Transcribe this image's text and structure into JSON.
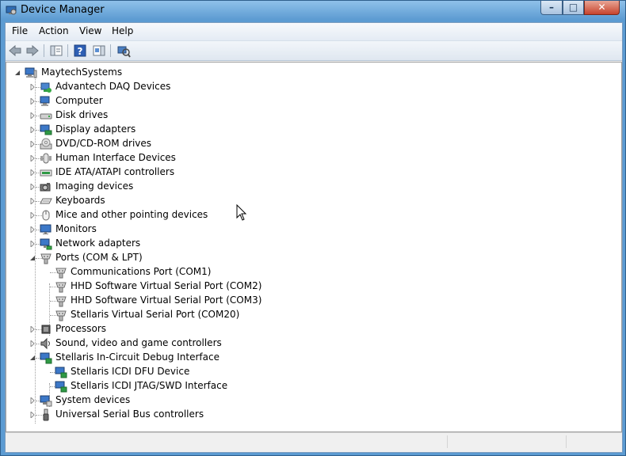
{
  "window": {
    "title": "Device Manager",
    "minimize": "–",
    "maximize": "□",
    "close": "✕"
  },
  "menu": {
    "file": "File",
    "action": "Action",
    "view": "View",
    "help": "Help"
  },
  "toolbar": [
    "back-icon",
    "forward-icon",
    "properties-pane-icon",
    "help-icon",
    "action-pane-icon",
    "scan-hardware-icon"
  ],
  "tree": {
    "root": "MaytechSystems",
    "categories": [
      {
        "label": "Advantech DAQ Devices",
        "icon": "daq-icon",
        "expanded": false
      },
      {
        "label": "Computer",
        "icon": "computer-icon",
        "expanded": false
      },
      {
        "label": "Disk drives",
        "icon": "disk-icon",
        "expanded": false
      },
      {
        "label": "Display adapters",
        "icon": "display-adapter-icon",
        "expanded": false
      },
      {
        "label": "DVD/CD-ROM drives",
        "icon": "dvd-icon",
        "expanded": false
      },
      {
        "label": "Human Interface Devices",
        "icon": "hid-icon",
        "expanded": false
      },
      {
        "label": "IDE ATA/ATAPI controllers",
        "icon": "ide-icon",
        "expanded": false
      },
      {
        "label": "Imaging devices",
        "icon": "camera-icon",
        "expanded": false
      },
      {
        "label": "Keyboards",
        "icon": "keyboard-icon",
        "expanded": false
      },
      {
        "label": "Mice and other pointing devices",
        "icon": "mouse-icon",
        "expanded": false
      },
      {
        "label": "Monitors",
        "icon": "monitor-icon",
        "expanded": false
      },
      {
        "label": "Network adapters",
        "icon": "network-icon",
        "expanded": false
      },
      {
        "label": "Ports (COM & LPT)",
        "icon": "port-icon",
        "expanded": true,
        "children": [
          {
            "label": "Communications Port (COM1)",
            "icon": "port-icon"
          },
          {
            "label": "HHD Software Virtual Serial Port (COM2)",
            "icon": "port-icon"
          },
          {
            "label": "HHD Software Virtual Serial Port (COM3)",
            "icon": "port-icon"
          },
          {
            "label": "Stellaris Virtual Serial Port (COM20)",
            "icon": "port-icon"
          }
        ]
      },
      {
        "label": "Processors",
        "icon": "processor-icon",
        "expanded": false
      },
      {
        "label": "Sound, video and game controllers",
        "icon": "speaker-icon",
        "expanded": false
      },
      {
        "label": "Stellaris In-Circuit Debug Interface",
        "icon": "debug-interface-icon",
        "expanded": true,
        "children": [
          {
            "label": "Stellaris ICDI DFU Device",
            "icon": "debug-interface-icon"
          },
          {
            "label": "Stellaris ICDI JTAG/SWD Interface",
            "icon": "debug-interface-icon"
          }
        ]
      },
      {
        "label": "System devices",
        "icon": "system-devices-icon",
        "expanded": false
      },
      {
        "label": "Universal Serial Bus controllers",
        "icon": "usb-icon",
        "expanded": false
      }
    ]
  }
}
